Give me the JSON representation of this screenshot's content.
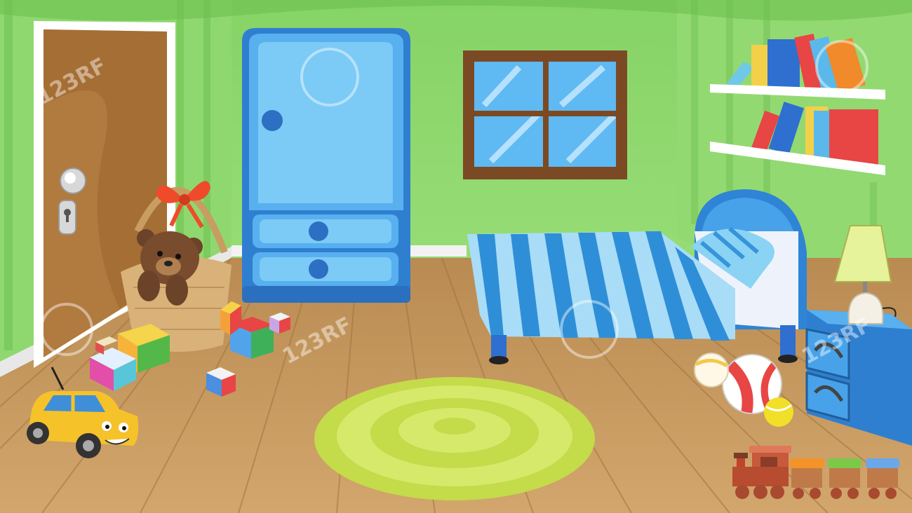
{
  "scene": {
    "type": "cartoon kids bedroom illustration",
    "objects": [
      "door",
      "wardrobe",
      "window",
      "bookshelves",
      "bed",
      "nightstand",
      "lamp",
      "basket",
      "teddy-bear",
      "toy-blocks",
      "toy-car",
      "rug",
      "balls",
      "toy-train"
    ]
  },
  "watermark": {
    "text": "123RF"
  },
  "colors": {
    "wall": "#9be07a",
    "wall_stripe": "#7cc95e",
    "floor": "#c79a62",
    "floor_line": "#a77a45",
    "door": "#a8733a",
    "wardrobe": "#3b8fe0",
    "bed_stripe": "#2e8fd8",
    "rug": "#cfe36a"
  }
}
